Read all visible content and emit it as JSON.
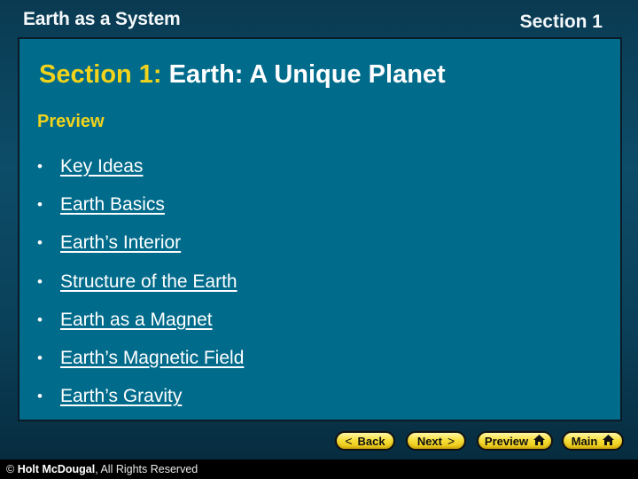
{
  "header": {
    "title": "Earth as a System",
    "section": "Section 1"
  },
  "slide": {
    "title_prefix": "Section 1:",
    "title_main": "Earth: A Unique Planet",
    "preview_label": "Preview",
    "bullet_glyph": "•",
    "topics": [
      {
        "label": "Key Ideas"
      },
      {
        "label": "Earth Basics"
      },
      {
        "label": "Earth’s Interior"
      },
      {
        "label": "Structure of the Earth"
      },
      {
        "label": "Earth as a Magnet"
      },
      {
        "label": "Earth’s Magnetic Field"
      },
      {
        "label": "Earth’s Gravity"
      }
    ]
  },
  "nav": {
    "back": {
      "label": "Back",
      "icon": "chevron-left-icon",
      "glyph": "<"
    },
    "next": {
      "label": "Next",
      "icon": "chevron-right-icon",
      "glyph": ">"
    },
    "preview": {
      "label": "Preview",
      "icon": "home-icon"
    },
    "main": {
      "label": "Main",
      "icon": "home-icon"
    }
  },
  "footer": {
    "copyright_symbol": "©",
    "publisher": "Holt McDougal",
    "rights": ", All Rights Reserved"
  },
  "colors": {
    "accent_yellow": "#f2d31b",
    "panel_teal": "#006b8b",
    "background_dark": "#0a3a52",
    "button_yellow": "#f6de3a"
  }
}
